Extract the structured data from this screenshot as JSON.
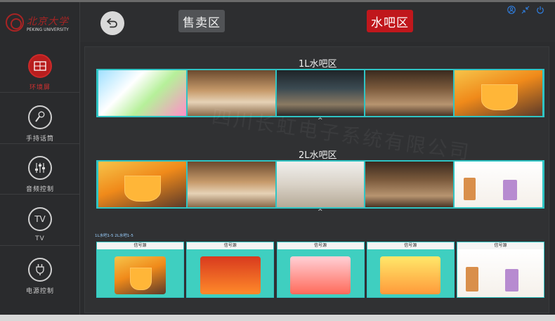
{
  "header": {
    "logo_cn": "北京大学",
    "logo_en": "PEKING UNIVERSITY",
    "sale_zone_label": "售卖区",
    "bar_zone_label": "水吧区",
    "icons": [
      "back-arrow-icon",
      "user-icon",
      "shrink-icon",
      "power-icon"
    ]
  },
  "sidebar": {
    "items": [
      {
        "label": "环境屏",
        "icon": "screen-icon",
        "active": true
      },
      {
        "label": "手持话筒",
        "icon": "microphone-icon",
        "active": false
      },
      {
        "label": "音频控制",
        "icon": "audio-sliders-icon",
        "active": false
      },
      {
        "label": "TV",
        "icon": "tv-icon",
        "active": false,
        "icon_text": "TV"
      },
      {
        "label": "电源控制",
        "icon": "plug-icon",
        "active": false
      }
    ]
  },
  "main": {
    "zone1_title": "1L水吧区",
    "zone2_title": "2L水吧区",
    "caret": "^",
    "source_hint": "1L水吧1-5   2L水吧1-5",
    "source_caption": "信号源",
    "source_count": 5,
    "watermark": "四川长虹电子系统有限公司"
  },
  "colors": {
    "accent_red": "#c0171c",
    "accent_cyan": "#2fc4c4",
    "icon_blue": "#2f7ee0"
  }
}
